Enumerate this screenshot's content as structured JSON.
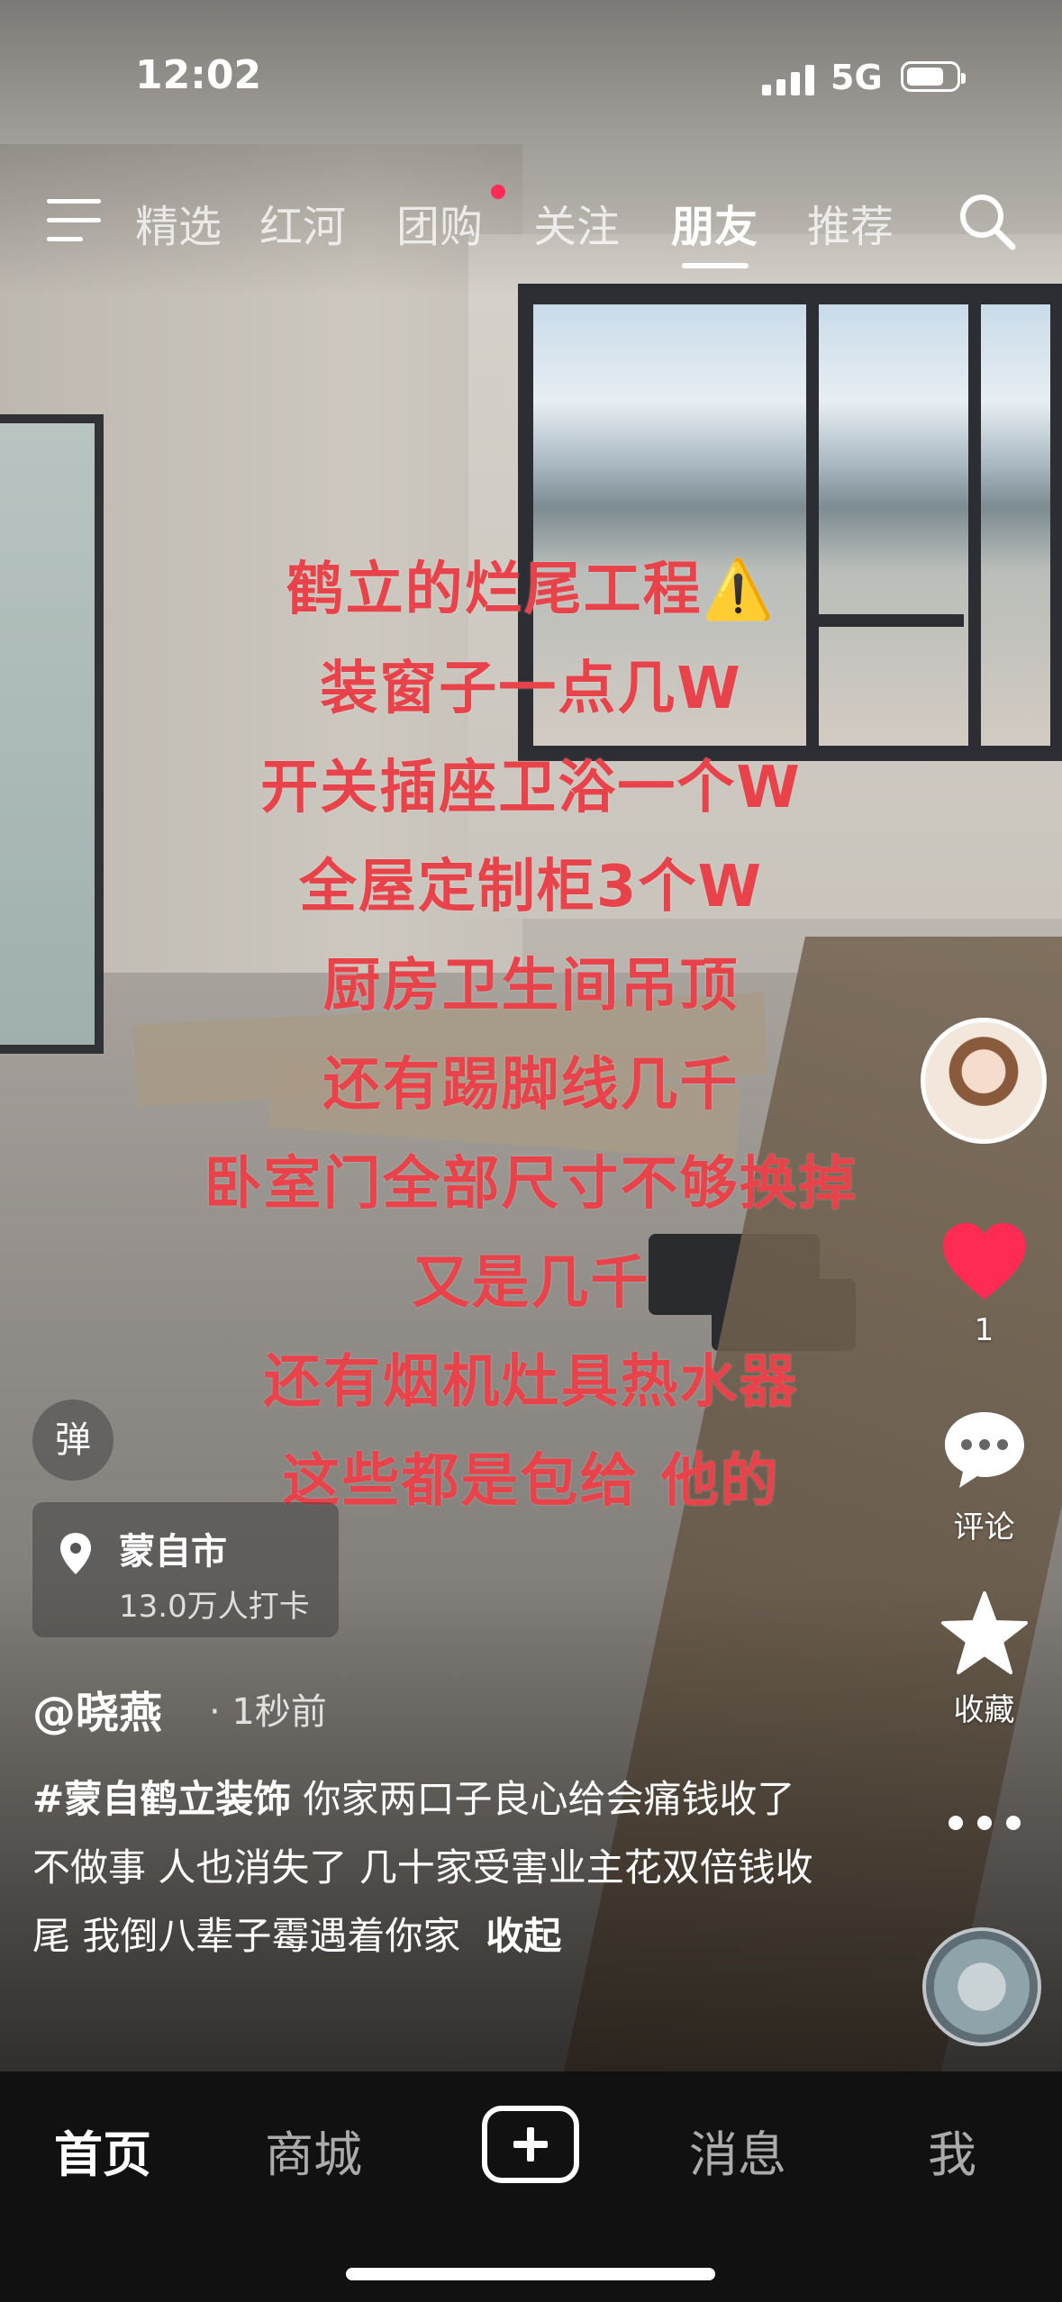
{
  "status_bar": {
    "time": "12:02",
    "network": "5G"
  },
  "top_tabs": [
    "精选",
    "红河",
    "团购",
    "关注",
    "朋友",
    "推荐"
  ],
  "active_tab": "朋友",
  "overlay_lines": [
    "鹤立的烂尾工程⚠️",
    "装窗子一点几W",
    "开关插座卫浴一个W",
    "全屋定制柜3个W",
    "厨房卫生间吊顶",
    "还有踢脚线几千",
    "卧室门全部尺寸不够换掉",
    "又是几千",
    "还有烟机灶具热水器",
    "这些都是包给 他的"
  ],
  "actions": {
    "like_count": "1",
    "comment_label": "评论",
    "favorite_label": "收藏"
  },
  "danmu_label": "弹",
  "location": {
    "city": "蒙自市",
    "checkins": "13.0万人打卡"
  },
  "author": {
    "name": "@晓燕",
    "time": "· 1秒前"
  },
  "description": {
    "hashtag": "#蒙自鹤立装饰",
    "text": " 你家两口子良心给会痛钱收了不做事 人也消失了 几十家受害业主花双倍钱收尾 我倒八辈子霉遇着你家",
    "fold_label": "收起"
  },
  "bottom_nav": {
    "home": "首页",
    "mall": "商城",
    "messages": "消息",
    "me": "我"
  },
  "colors": {
    "overlay_text": "#e8434a",
    "like_red": "#fe2c55"
  }
}
